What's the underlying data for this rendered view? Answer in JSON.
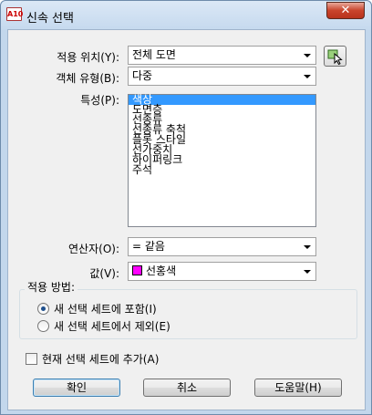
{
  "window": {
    "title": "신속 선택",
    "app_icon_text": "A10",
    "close_label": "✕"
  },
  "apply_to": {
    "label": "적용 위치(Y):",
    "value": "전체 도면"
  },
  "object_type": {
    "label": "객체 유형(B):",
    "value": "다중"
  },
  "properties": {
    "label": "특성(P):",
    "items": [
      "색상",
      "도면층",
      "선종류",
      "선종류 축척",
      "플롯 스타일",
      "선가중치",
      "하이퍼링크",
      "주석"
    ],
    "selected_index": 0
  },
  "operator": {
    "label": "연산자(O):",
    "value": "= 같음"
  },
  "value": {
    "label": "값(V):",
    "value": "선홍색",
    "swatch_color": "#ff00ff"
  },
  "how_to_apply": {
    "title": "적용 방법:",
    "include": "새 선택 세트에 포함(I)",
    "exclude": "새 선택 세트에서 제외(E)",
    "selected": "include"
  },
  "append": {
    "label": "현재 선택 세트에 추가(A)",
    "checked": false
  },
  "buttons": {
    "ok": "확인",
    "cancel": "취소",
    "help": "도움말(H)"
  },
  "icons": {
    "pick": "select-objects-icon"
  }
}
